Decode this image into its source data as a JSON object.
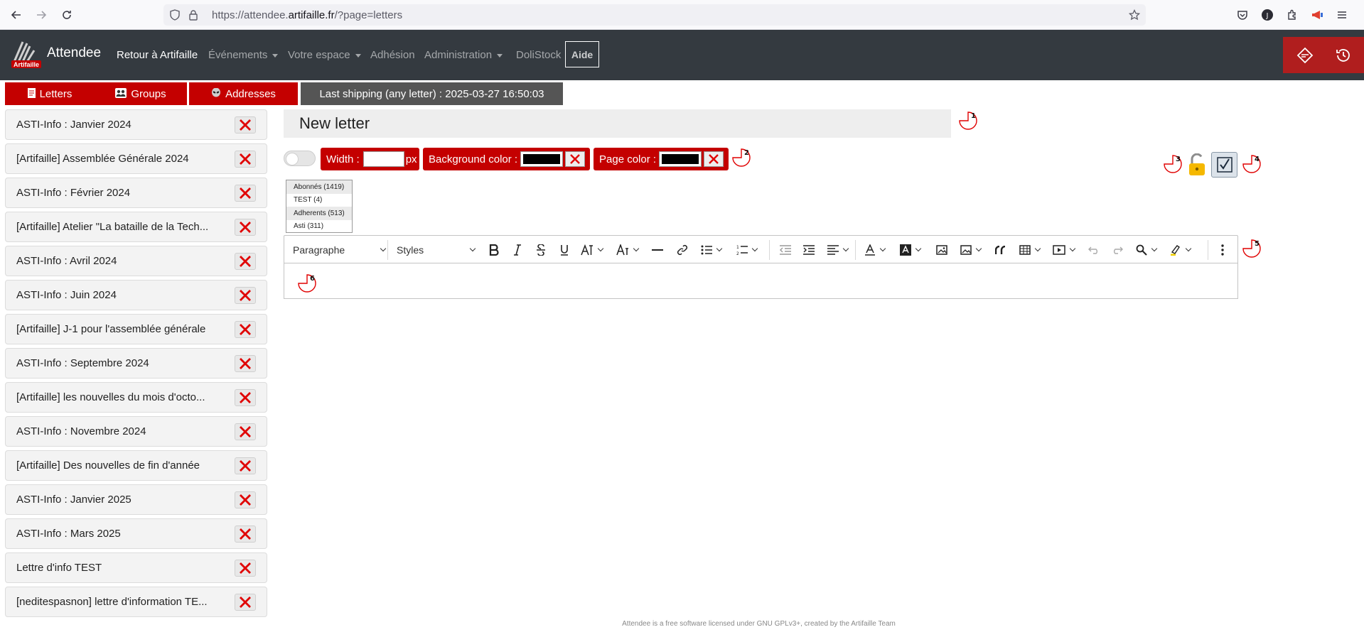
{
  "browser": {
    "url_prefix": "https://attendee.",
    "url_domain": "artifaille.fr",
    "url_suffix": "/?page=letters"
  },
  "navbar": {
    "brand": "Attendee",
    "logo_text": "Artifaille",
    "links": [
      {
        "label": "Retour à Artifaille",
        "dropdown": false
      },
      {
        "label": "Événements",
        "dropdown": true
      },
      {
        "label": "Votre espace",
        "dropdown": true
      },
      {
        "label": "Adhésion",
        "dropdown": false
      },
      {
        "label": "Administration",
        "dropdown": true
      },
      {
        "label": "DoliStock",
        "dropdown": false
      }
    ],
    "aide": "Aide",
    "accent_color": "#b01e1e",
    "bg_color": "#343a40"
  },
  "tabs": [
    {
      "label": "Letters",
      "icon": "document-icon"
    },
    {
      "label": "Groups",
      "icon": "people-icon"
    },
    {
      "label": "Addresses",
      "icon": "alien-icon"
    }
  ],
  "last_shipping": "Last shipping (any letter) : 2025-03-27 16:50:03",
  "letters": [
    "ASTI-Info : Janvier 2024",
    "[Artifaille] Assemblée Générale 2024",
    "ASTI-Info : Février 2024",
    "[Artifaille] Atelier \"La bataille de la Tech...",
    "ASTI-Info : Avril 2024",
    "ASTI-Info : Juin 2024",
    "[Artifaille] J-1 pour l'assemblée générale",
    "ASTI-Info : Septembre 2024",
    "[Artifaille] les nouvelles du mois d'octo...",
    "ASTI-Info : Novembre 2024",
    "[Artifaille] Des nouvelles de fin d'année",
    "ASTI-Info : Janvier 2025",
    "ASTI-Info : Mars 2025",
    "Lettre d'info TEST",
    "[neditespasnon] lettre d'information TE..."
  ],
  "editor": {
    "title": "New letter",
    "width_label": "Width :",
    "width_unit": "px",
    "width_value": "",
    "bg_color_label": "Background color :",
    "page_color_label": "Page color :",
    "groups": [
      {
        "label": "Abonnés (1419)",
        "selected": true
      },
      {
        "label": "TEST (4)",
        "selected": false
      },
      {
        "label": "Adherents (513)",
        "selected": true
      },
      {
        "label": "Asti (311)",
        "selected": false
      }
    ],
    "paragraph_select": "Paragraphe",
    "styles_select": "Styles",
    "help_markers": [
      "1",
      "2",
      "3",
      "4",
      "5",
      "6"
    ]
  },
  "footer": "Attendee is a free software licensed under GNU GPLv3+, created by the Artifaille Team"
}
